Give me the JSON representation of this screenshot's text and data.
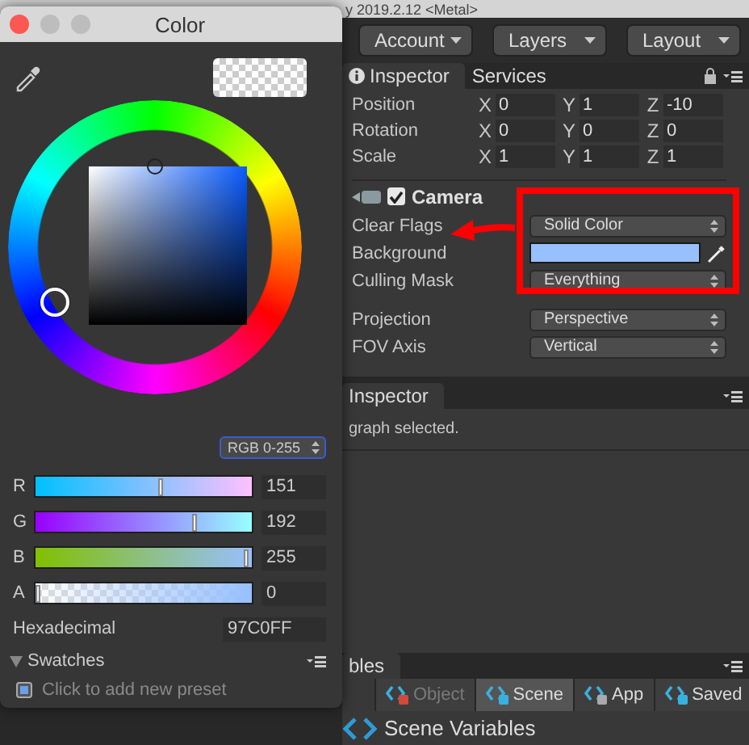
{
  "editor_title": "y 2019.2.12 <Metal>",
  "toolbar": {
    "buttons": [
      "Account",
      "Layers",
      "Layout"
    ]
  },
  "inspector": {
    "tabs": [
      {
        "label": "Inspector",
        "selected": true
      },
      {
        "label": "Services",
        "selected": false
      }
    ],
    "transform": [
      {
        "label": "Position",
        "fields": [
          {
            "axis": "X",
            "value": "0"
          },
          {
            "axis": "Y",
            "value": "1"
          },
          {
            "axis": "Z",
            "value": "-10"
          }
        ]
      },
      {
        "label": "Rotation",
        "fields": [
          {
            "axis": "X",
            "value": "0"
          },
          {
            "axis": "Y",
            "value": "0"
          },
          {
            "axis": "Z",
            "value": "0"
          }
        ]
      },
      {
        "label": "Scale",
        "fields": [
          {
            "axis": "X",
            "value": "1"
          },
          {
            "axis": "Y",
            "value": "1"
          },
          {
            "axis": "Z",
            "value": "1"
          }
        ]
      }
    ],
    "camera": {
      "title": "Camera",
      "enabled": true,
      "properties": [
        {
          "kind": "dropdown",
          "label": "Clear Flags",
          "value": "Solid Color"
        },
        {
          "kind": "color",
          "label": "Background",
          "color": "#97c0ff"
        },
        {
          "kind": "dropdown",
          "label": "Culling Mask",
          "value": "Everything"
        },
        {
          "kind": "dropdown",
          "label": "Projection",
          "value": "Perspective"
        },
        {
          "kind": "dropdown",
          "label": "FOV Axis",
          "value": "Vertical"
        }
      ]
    }
  },
  "graph_inspector": {
    "tab": "Inspector",
    "message": "graph selected."
  },
  "variables": {
    "tab": "bles",
    "buttons": [
      {
        "label": "Object",
        "selected": false,
        "disabled": true
      },
      {
        "label": "Scene",
        "selected": true,
        "disabled": false
      },
      {
        "label": "App",
        "selected": false,
        "disabled": false
      },
      {
        "label": "Saved",
        "selected": false,
        "disabled": false
      }
    ],
    "heading": "Scene Variables"
  },
  "color_window": {
    "title": "Color",
    "mode": "RGB 0-255",
    "channels": [
      {
        "label": "R",
        "value": "151",
        "level": 0.592
      },
      {
        "label": "G",
        "value": "192",
        "level": 0.753
      },
      {
        "label": "B",
        "value": "255",
        "level": 1
      },
      {
        "label": "A",
        "value": "0",
        "level": 0
      }
    ],
    "hex": {
      "label": "Hexadecimal",
      "value": "97C0FF"
    },
    "swatches": {
      "title": "Swatches",
      "expanded": true,
      "hint": "Click to add new preset"
    }
  }
}
